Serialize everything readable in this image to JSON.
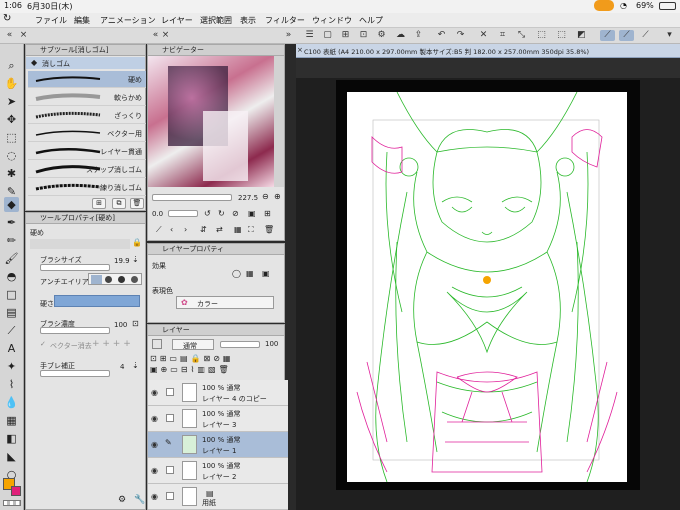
{
  "status_bar": {
    "time": "1:06",
    "date": "6月30日(木)",
    "battery": "69%"
  },
  "menu": [
    "ファイル",
    "編集",
    "アニメーション",
    "レイヤー",
    "選択範囲",
    "表示",
    "フィルター",
    "ウィンドウ",
    "ヘルプ"
  ],
  "subtool_panel": {
    "title": "サブツール[消しゴム]",
    "group": "消しゴム",
    "brushes": [
      "硬め",
      "軟らかめ",
      "ざっくり",
      "ベクター用",
      "レイヤー貫通",
      "スナップ消しゴム",
      "練り消しゴム"
    ]
  },
  "navigator_panel": {
    "title": "ナビゲーター",
    "zoom": "227.5",
    "rotation": "0.0"
  },
  "tool_property": {
    "title": "ツールプロパティ[硬め]",
    "preset_name": "硬め",
    "brush_size_label": "ブラシサイズ",
    "brush_size_value": "19.9",
    "antialias_label": "アンチエイリアス",
    "hardness_label": "硬さ",
    "brush_density_label": "ブラシ濃度",
    "brush_density_value": "100",
    "vector_erase_label": "ベクター消去",
    "stabilization_label": "手ブレ補正",
    "stabilization_value": "4"
  },
  "layer_property": {
    "title": "レイヤープロパティ",
    "effect_label": "効果",
    "expression_color_label": "表現色",
    "expression_color_value": "カラー"
  },
  "layer_panel": {
    "title": "レイヤー",
    "blend_mode": "通常",
    "opacity": "100",
    "layers": [
      {
        "percent_mode": "100 % 通常",
        "name": "レイヤー 4 のコピー",
        "selected": false
      },
      {
        "percent_mode": "100 % 通常",
        "name": "レイヤー 3",
        "selected": false
      },
      {
        "percent_mode": "100 % 通常",
        "name": "レイヤー 1",
        "selected": true
      },
      {
        "percent_mode": "100 % 通常",
        "name": "レイヤー 2",
        "selected": false
      },
      {
        "percent_mode": "",
        "name": "用紙",
        "selected": false
      }
    ]
  },
  "canvas": {
    "tab_title": "C100 表紙 (A4 210.00 x 297.00mm 製本サイズ:B5 判 182.00 x 257.00mm 350dpi 35.8%)"
  },
  "colors": {
    "main": "#f5a400",
    "sub": "#e0207a",
    "selection": "#a9bdd8",
    "sketch_green": "#29b829",
    "sketch_magenta": "#e0209a"
  }
}
